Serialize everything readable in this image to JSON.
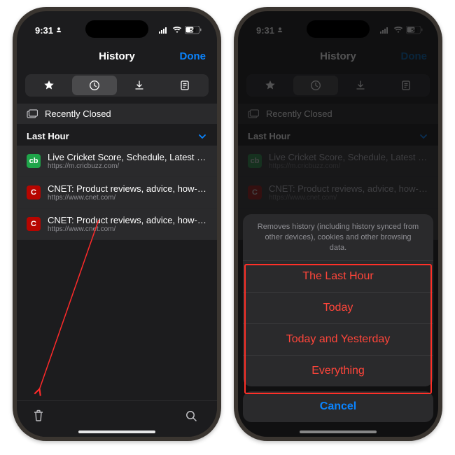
{
  "status": {
    "time": "9:31",
    "battery_text": "58"
  },
  "nav": {
    "title": "History",
    "done": "Done"
  },
  "section_recent": "Recently Closed",
  "section_lasthour": "Last Hour",
  "entries": [
    {
      "title": "Live Cricket Score, Schedule, Latest News,...",
      "url": "https://m.cricbuzz.com/",
      "fav": "cb",
      "cls": "fav-green"
    },
    {
      "title": "CNET: Product reviews, advice, how-tos and...",
      "url": "https://www.cnet.com/",
      "fav": "C",
      "cls": "fav-red"
    },
    {
      "title": "CNET: Product reviews, advice, how-tos and...",
      "url": "https://www.cnet.com/",
      "fav": "C",
      "cls": "fav-red"
    }
  ],
  "sheet": {
    "desc": "Removes history (including history synced from other devices), cookies and other browsing data.",
    "options": [
      "The Last Hour",
      "Today",
      "Today and Yesterday",
      "Everything"
    ],
    "cancel": "Cancel"
  }
}
